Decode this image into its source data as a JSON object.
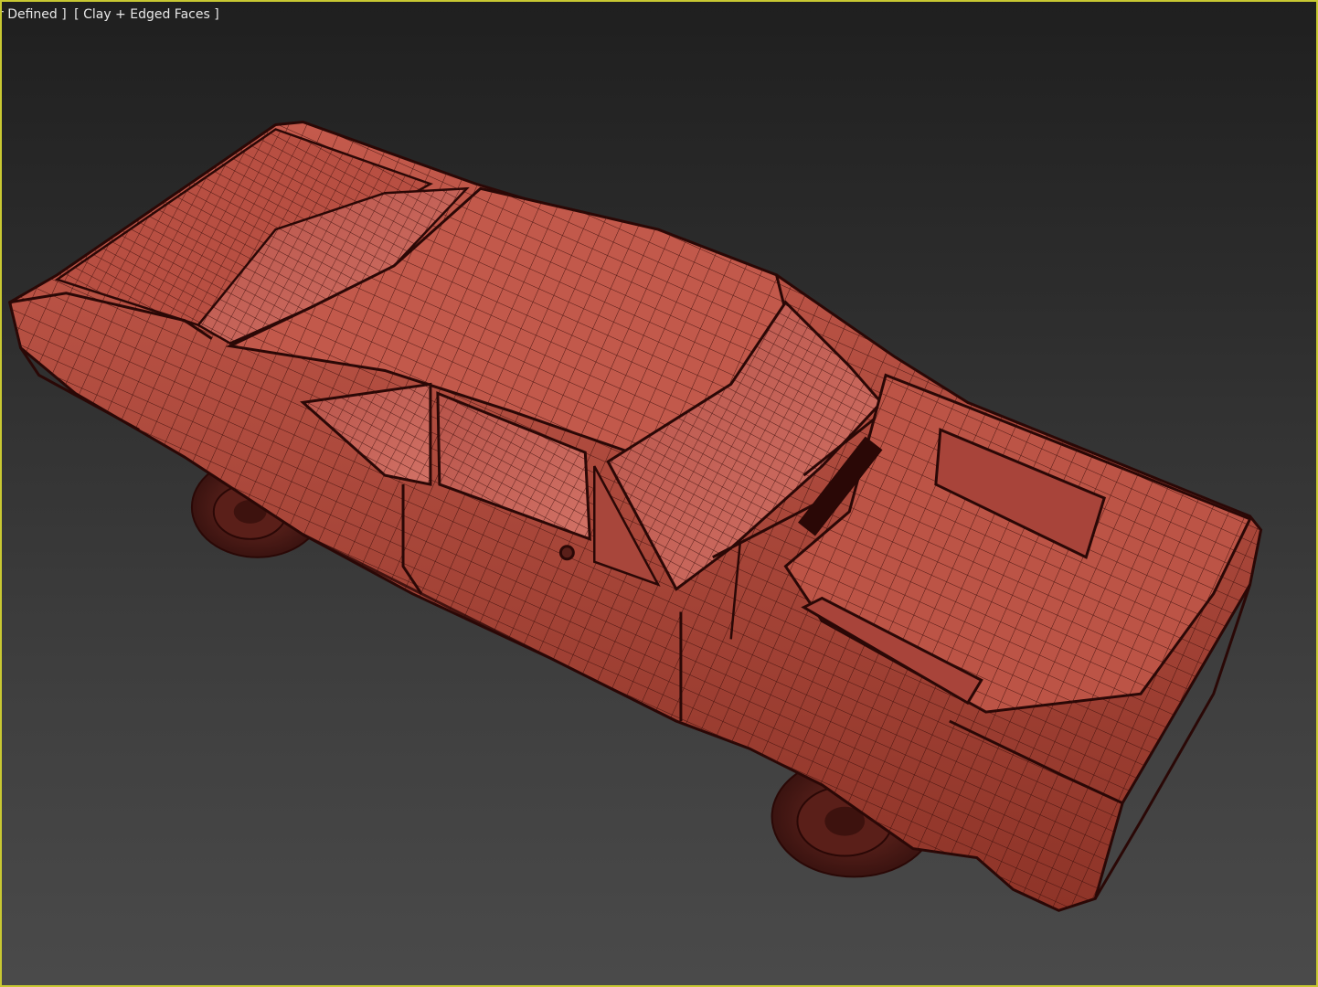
{
  "viewport": {
    "label_view": "r Defined ]",
    "label_mode": "[ Clay + Edged Faces ]",
    "border_color": "#c8c832",
    "background_top": "#1f1f1f",
    "background_bottom": "#4a4a4a",
    "model_color": "#b04a3e",
    "edge_color": "#3a0e0a"
  }
}
